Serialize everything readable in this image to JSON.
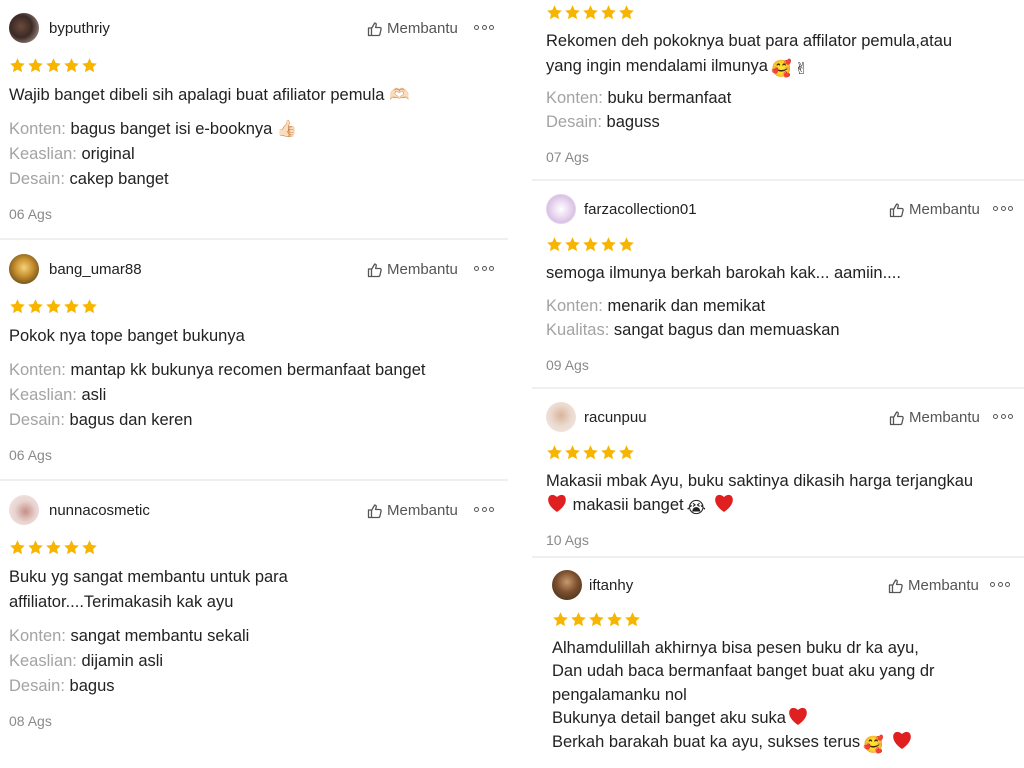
{
  "labels": {
    "helpful": "Membantu"
  },
  "colors": {
    "star": "#f7b500",
    "divider": "#efefef",
    "attr_key": "#a3a3a3",
    "heart": "#e02020"
  },
  "reviews_left": [
    {
      "username": "byputhriy",
      "rating": 5,
      "text": [
        "Wajib banget dibeli sih apalagi buat afiliator pemula 🫶🏻"
      ],
      "attributes": [
        {
          "key": "Konten:",
          "value": "bagus banget isi e-booknya 👍🏻"
        },
        {
          "key": "Keaslian:",
          "value": "original"
        },
        {
          "key": "Desain:",
          "value": "cakep banget"
        }
      ],
      "date": "06 Ags"
    },
    {
      "username": "bang_umar88",
      "rating": 5,
      "text": [
        "Pokok nya tope banget bukunya"
      ],
      "attributes": [
        {
          "key": "Konten:",
          "value": "mantap kk bukunya recomen bermanfaat banget"
        },
        {
          "key": "Keaslian:",
          "value": "asli"
        },
        {
          "key": "Desain:",
          "value": "bagus dan keren"
        }
      ],
      "date": "06 Ags"
    },
    {
      "username": "nunnacosmetic",
      "rating": 5,
      "text": [
        "Buku yg sangat membantu untuk para",
        "affiliator....Terimakasih kak ayu"
      ],
      "attributes": [
        {
          "key": "Konten:",
          "value": "sangat membantu sekali"
        },
        {
          "key": "Keaslian:",
          "value": "dijamin asli"
        },
        {
          "key": "Desain:",
          "value": "bagus"
        }
      ],
      "date": "08 Ags"
    }
  ],
  "reviews_right": [
    {
      "rating": 5,
      "text": [
        "Rekomen deh pokoknya buat para affilator pemula,atau",
        "yang ingin mendalami ilmunya"
      ],
      "text_emoji": [
        "🥰",
        "✌"
      ],
      "attributes": [
        {
          "key": "Konten:",
          "value": "buku bermanfaat"
        },
        {
          "key": "Desain:",
          "value": "baguss"
        }
      ],
      "date": "07 Ags"
    },
    {
      "username": "farzacollection01",
      "rating": 5,
      "text": [
        "semoga ilmunya berkah barokah kak... aamiin...."
      ],
      "attributes": [
        {
          "key": "Konten:",
          "value": "menarik dan memikat"
        },
        {
          "key": "Kualitas:",
          "value": "sangat bagus dan memuaskan"
        }
      ],
      "date": "09 Ags"
    },
    {
      "username": "racunpuu",
      "rating": 5,
      "text": [
        "Makasii mbak Ayu, buku saktinya dikasih harga terjangkau",
        "makasii banget"
      ],
      "text_emoji": [
        "😭"
      ],
      "date": "10 Ags"
    },
    {
      "username": "iftanhy",
      "rating": 5,
      "text": [
        "Alhamdulillah akhirnya bisa pesen buku dr ka ayu,",
        "Dan udah baca bermanfaat banget buat aku yang dr",
        "pengalamanku nol",
        "Bukunya detail banget aku suka",
        "Berkah barakah buat ka ayu, sukses terus"
      ],
      "text_emoji": [
        "🥰"
      ]
    }
  ]
}
